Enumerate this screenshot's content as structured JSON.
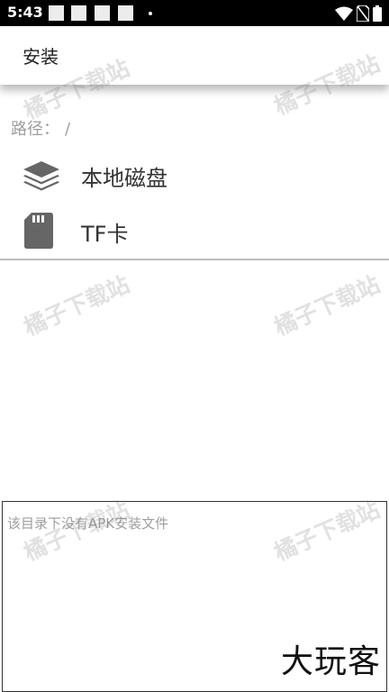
{
  "status_bar": {
    "time": "5:43",
    "notification_icons": [
      "notification-icon",
      "notification-icon",
      "notification-icon",
      "notification-icon"
    ],
    "right_icons": [
      "wifi-icon",
      "no-sim-icon",
      "battery-icon"
    ]
  },
  "app_bar": {
    "title": "安装"
  },
  "path": {
    "label": "路径：",
    "value": "/"
  },
  "storage_items": [
    {
      "label": "本地磁盘",
      "icon": "layers-icon"
    },
    {
      "label": "TF卡",
      "icon": "sd-card-icon"
    }
  ],
  "panel": {
    "message": "该目录下没有APK安装文件",
    "logo_text": "大玩客"
  },
  "watermark": "橘子下载站",
  "colors": {
    "status_bar": "#000000",
    "icon_gray": "#666666",
    "divider": "#bdbdbd",
    "muted_text": "#9e9e9e"
  }
}
